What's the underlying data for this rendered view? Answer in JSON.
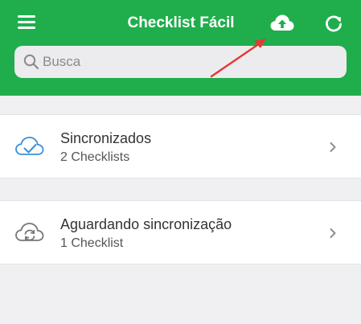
{
  "header": {
    "title": "Checklist Fácil",
    "icons": {
      "menu": "hamburger-menu-icon",
      "upload": "cloud-upload-icon",
      "refresh": "refresh-icon"
    },
    "background_color": "#1fae4b"
  },
  "search": {
    "placeholder": "Busca",
    "value": ""
  },
  "annotation": {
    "arrow_color": "#e53935"
  },
  "list": {
    "items": [
      {
        "title": "Sincronizados",
        "subtitle": "2 Checklists",
        "icon": "cloud-check-icon",
        "icon_color": "#3b8fd9"
      },
      {
        "title": "Aguardando sincronização",
        "subtitle": "1 Checklist",
        "icon": "cloud-sync-icon",
        "icon_color": "#777777"
      }
    ]
  }
}
